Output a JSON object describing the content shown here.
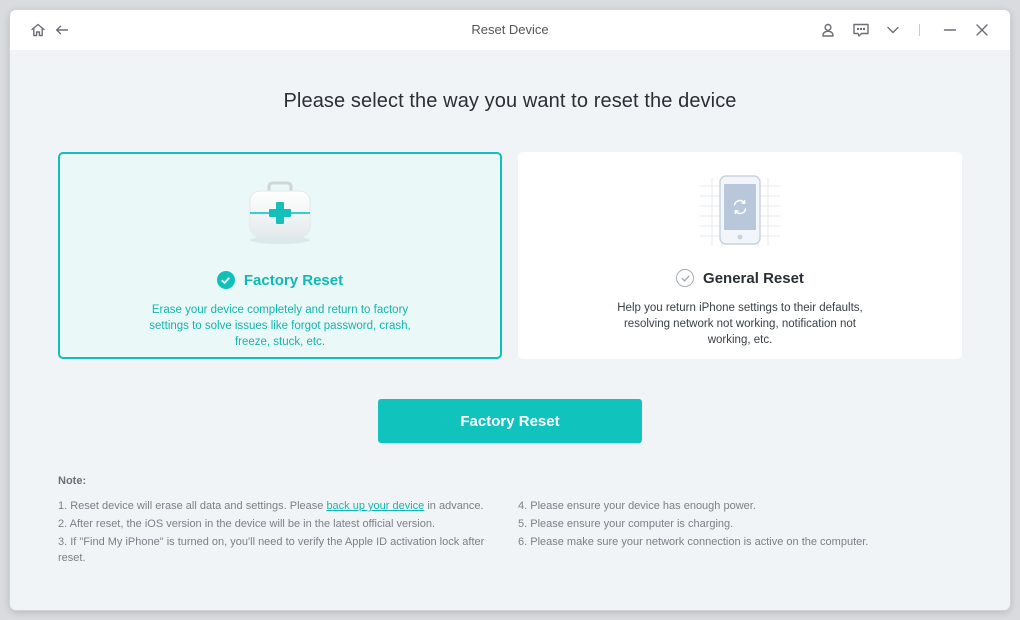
{
  "window": {
    "title": "Reset Device"
  },
  "titlebar_icons": {
    "home": "home-icon",
    "back": "arrow-left-icon",
    "account": "user-icon",
    "feedback": "chat-icon",
    "menu": "chevron-down-icon",
    "minimize": "minimize-icon",
    "close": "close-icon"
  },
  "heading": "Please select the way you want to reset the device",
  "options": [
    {
      "name": "Factory Reset",
      "description": "Erase your device completely and return to factory settings to solve issues like forgot password, crash, freeze, stuck, etc.",
      "selected": true,
      "icon": "first-aid-kit-icon"
    },
    {
      "name": "General Reset",
      "description": "Help you return iPhone settings to their defaults, resolving network not working, notification not working, etc.",
      "selected": false,
      "icon": "phone-sync-icon"
    }
  ],
  "action_button": "Factory Reset",
  "notes": {
    "label": "Note:",
    "item1_before": "1. Reset device will erase all data and settings. Please ",
    "item1_link": "back up your device",
    "item1_after": " in advance.",
    "item2": "2. After reset, the iOS version in the device will be in the latest official version.",
    "item3": "3. If \"Find My iPhone\" is turned on, you'll need to verify the Apple ID activation lock after reset.",
    "item4": "4. Please ensure your device has enough power.",
    "item5": "5. Please ensure your computer is charging.",
    "item6": "6. Please make sure your network connection is active on the computer."
  },
  "colors": {
    "accent": "#10c3bc",
    "selected_bg": "#eaf8f8",
    "window_bg": "#f1f4f7"
  }
}
